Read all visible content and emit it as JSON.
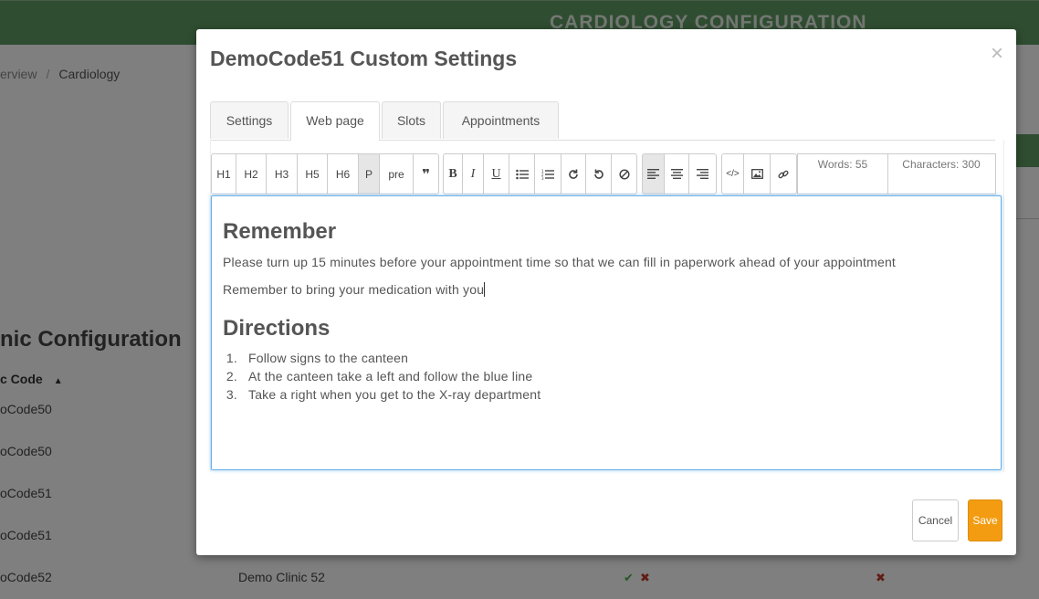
{
  "background": {
    "header_title": "CARDIOLOGY CONFIGURATION",
    "breadcrumb": [
      "erview",
      "Cardiology"
    ],
    "section_title": "nic Configuration",
    "column_header": "c Code",
    "rows": [
      {
        "code": "oCode50",
        "name": ""
      },
      {
        "code": "oCode50",
        "name": ""
      },
      {
        "code": "oCode51",
        "name": ""
      },
      {
        "code": "oCode51",
        "name": ""
      },
      {
        "code": "oCode52",
        "name": "Demo Clinic 52"
      }
    ]
  },
  "modal": {
    "title": "DemoCode51 Custom Settings",
    "close_symbol": "×",
    "tabs": [
      {
        "label": "Settings",
        "active": false
      },
      {
        "label": "Web page",
        "active": true
      },
      {
        "label": "Slots",
        "active": false
      },
      {
        "label": "Appointments",
        "active": false
      }
    ],
    "toolbar": {
      "headings": [
        "H1",
        "H2",
        "H3",
        "H5",
        "H6",
        "P",
        "pre",
        "❞"
      ],
      "active_heading": "P",
      "format_buttons": [
        "bold-icon",
        "italic-icon",
        "underline-icon",
        "bulleted-list-icon",
        "numbered-list-icon",
        "redo-icon",
        "undo-icon",
        "clear-format-icon"
      ],
      "align_buttons": [
        "align-left-icon",
        "align-center-icon",
        "align-right-icon"
      ],
      "insert_buttons": [
        "code-view-icon",
        "image-icon",
        "link-icon"
      ],
      "words": "Words: 55",
      "characters": "Characters: 300"
    },
    "content": {
      "heading1": "Remember",
      "para1": "Please turn up 15 minutes before your appointment time so that we can fill in paperwork ahead of your appointment",
      "para2": "Remember to bring your medication with you",
      "heading2": "Directions",
      "list": [
        {
          "num": "1.",
          "text": "Follow signs to the canteen"
        },
        {
          "num": "2.",
          "text": "At the canteen take a left and follow the blue line"
        },
        {
          "num": "3.",
          "text": "Take a right when you get to the X-ray department"
        }
      ]
    },
    "cancel_label": "Cancel",
    "save_label": "Save"
  }
}
